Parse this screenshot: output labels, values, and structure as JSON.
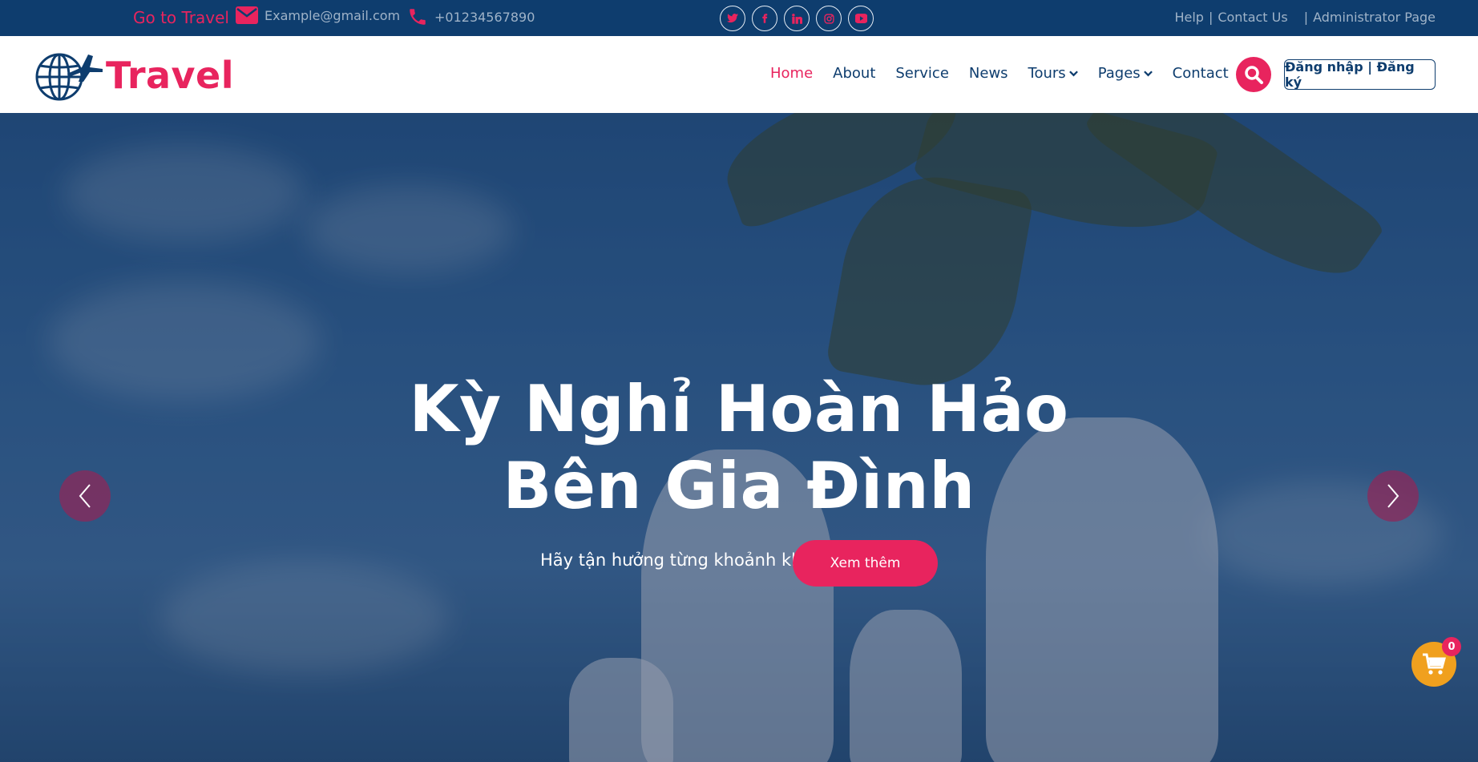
{
  "topbar": {
    "brand_link": "Go to Travel",
    "email": "Example@gmail.com",
    "phone": "+01234567890",
    "social": [
      "twitter-icon",
      "facebook-icon",
      "linkedin-icon",
      "instagram-icon",
      "youtube-icon"
    ],
    "help": "Help",
    "contact_us": "Contact Us",
    "admin": "Administrator Page",
    "separator": "|"
  },
  "navbar": {
    "logo_text": "Travel",
    "menu": [
      {
        "label": "Home",
        "active": true
      },
      {
        "label": "About"
      },
      {
        "label": "Service"
      },
      {
        "label": "News"
      },
      {
        "label": "Tours",
        "dropdown": true
      },
      {
        "label": "Pages",
        "dropdown": true
      },
      {
        "label": "Contact"
      }
    ],
    "login_label": "Đăng nhập | Đăng ký"
  },
  "hero": {
    "title_line1": "Kỳ Nghỉ Hoàn Hảo",
    "title_line2": "Bên Gia Đình",
    "subtitle": "Hãy tận hưởng từng khoảnh khắc",
    "button_label": "Xem thêm"
  },
  "cart": {
    "count": "0"
  },
  "colors": {
    "primary": "#e8245e",
    "navy": "#0e3d6e",
    "cart": "#f0a01e"
  }
}
